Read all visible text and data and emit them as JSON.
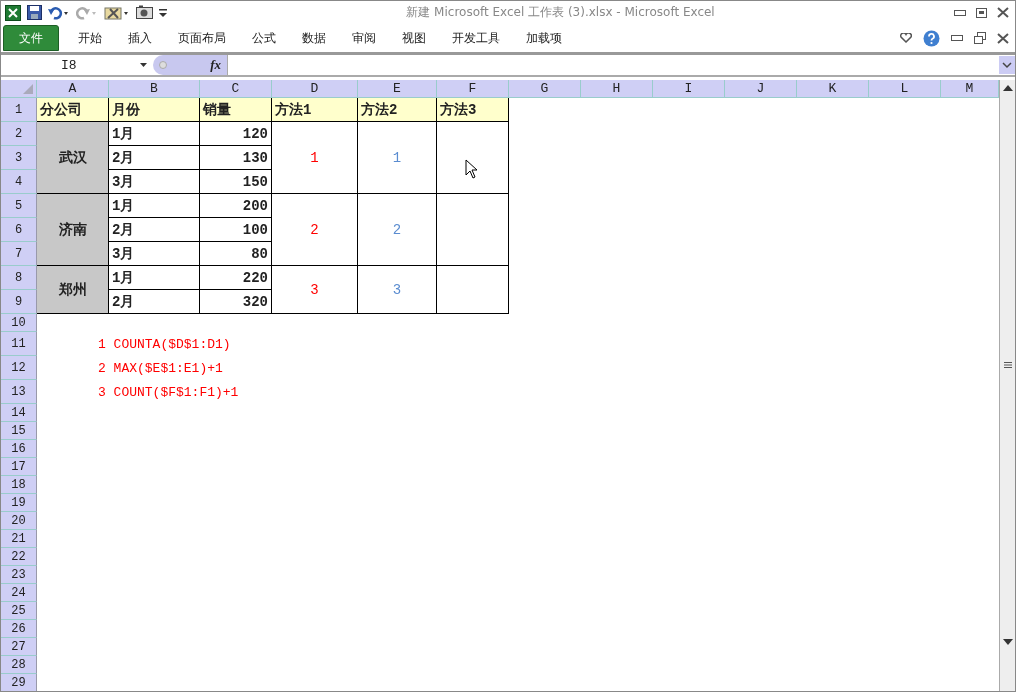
{
  "window": {
    "title": "新建 Microsoft Excel 工作表 (3).xlsx  -  Microsoft Excel"
  },
  "ribbon_tabs": [
    {
      "label": "文件",
      "kind": "file"
    },
    {
      "label": "开始",
      "kind": "tab"
    },
    {
      "label": "插入",
      "kind": "tab"
    },
    {
      "label": "页面布局",
      "kind": "tab"
    },
    {
      "label": "公式",
      "kind": "tab"
    },
    {
      "label": "数据",
      "kind": "tab"
    },
    {
      "label": "审阅",
      "kind": "tab"
    },
    {
      "label": "视图",
      "kind": "tab"
    },
    {
      "label": "开发工具",
      "kind": "tab"
    },
    {
      "label": "加载项",
      "kind": "tab"
    }
  ],
  "name_box": "I8",
  "formula_label": "fx",
  "columns": [
    "A",
    "B",
    "C",
    "D",
    "E",
    "F",
    "G",
    "H",
    "I",
    "J",
    "K",
    "L",
    "M"
  ],
  "row_numbers": [
    "1",
    "2",
    "3",
    "4",
    "5",
    "6",
    "7",
    "8",
    "9",
    "10",
    "11",
    "12",
    "13",
    "14",
    "15",
    "16",
    "17",
    "18",
    "19",
    "20",
    "21",
    "22",
    "23",
    "24",
    "25",
    "26",
    "27",
    "28",
    "29"
  ],
  "table": {
    "header": [
      "分公司",
      "月份",
      "销量",
      "方法1",
      "方法2",
      "方法3"
    ],
    "groups": [
      {
        "branch": "武汉",
        "months": [
          {
            "month": "1月",
            "sales": "120"
          },
          {
            "month": "2月",
            "sales": "130"
          },
          {
            "month": "3月",
            "sales": "150"
          }
        ],
        "method1": "1",
        "method2": "1"
      },
      {
        "branch": "济南",
        "months": [
          {
            "month": "1月",
            "sales": "200"
          },
          {
            "month": "2月",
            "sales": "100"
          },
          {
            "month": "3月",
            "sales": "80"
          }
        ],
        "method1": "2",
        "method2": "2"
      },
      {
        "branch": "郑州",
        "months": [
          {
            "month": "1月",
            "sales": "220"
          },
          {
            "month": "2月",
            "sales": "320"
          }
        ],
        "method1": "3",
        "method2": "3"
      }
    ]
  },
  "notes": [
    "1 COUNTA($D$1:D1)",
    "2 MAX($E$1:E1)+1",
    "3 COUNT($F$1:F1)+1"
  ]
}
